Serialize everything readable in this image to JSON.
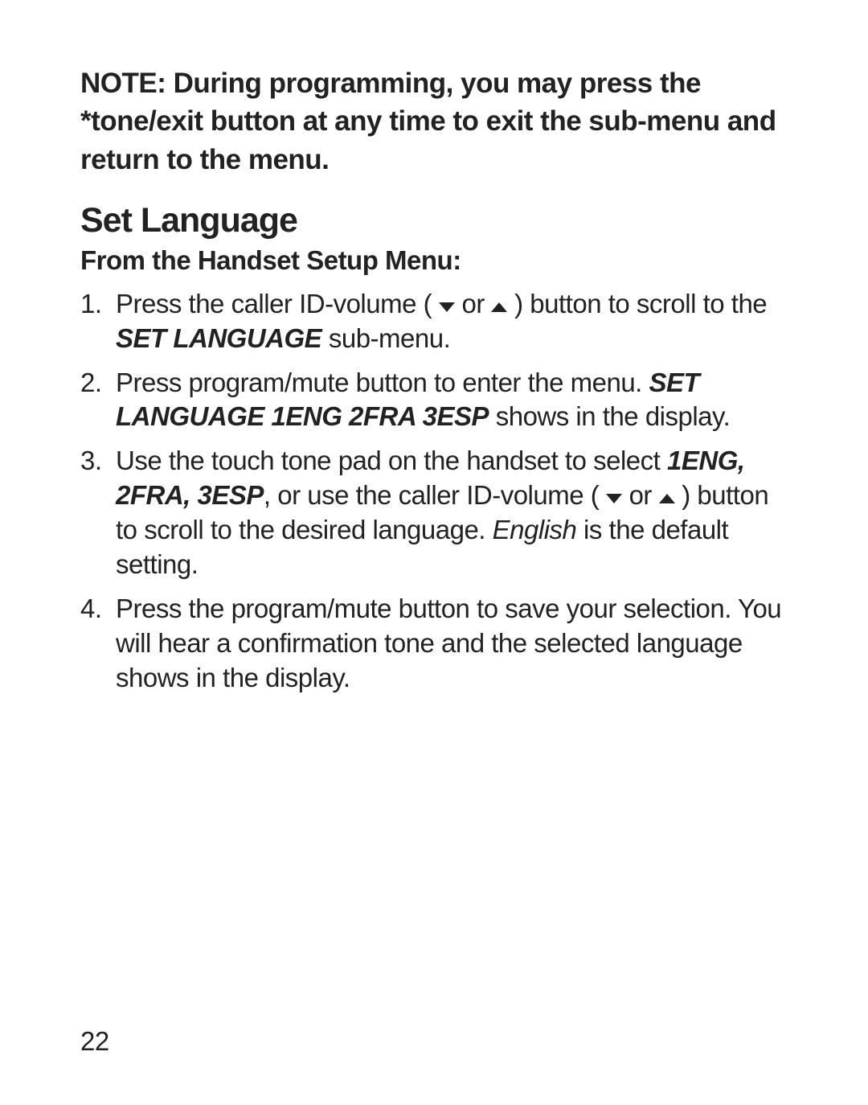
{
  "note": "NOTE: During programming, you may press the *tone/exit button at any time to exit the sub-menu and return to the menu.",
  "heading": "Set Language",
  "subheading": "From the Handset Setup Menu:",
  "steps": {
    "s1": {
      "a": "Press the caller ID-volume ( ",
      "or": " or ",
      "b": " ) button to scroll to the ",
      "c_bi": "SET LANGUAGE",
      "d": " sub-menu."
    },
    "s2": {
      "a": "Press program/mute button to enter the menu. ",
      "b_bi": "SET LANGUAGE 1ENG 2FRA 3ESP",
      "c": " shows in the display."
    },
    "s3": {
      "a": "Use the touch tone pad on the handset to select ",
      "b_bi": "1ENG, 2FRA, 3ESP",
      "c": ", or use the caller ID-volume ( ",
      "or": " or ",
      "d": " ) button to scroll to the desired language. ",
      "e_i": "English",
      "f": " is the default setting."
    },
    "s4": {
      "a": "Press the program/mute button to save your selection. You will hear a confirmation tone and the selected language shows in the display."
    }
  },
  "page_number": "22"
}
